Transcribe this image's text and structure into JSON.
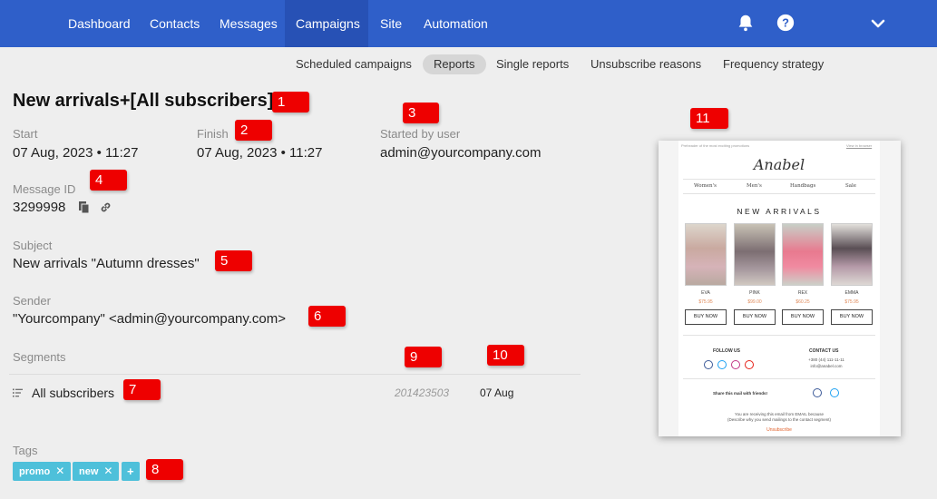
{
  "nav": {
    "items": [
      "Dashboard",
      "Contacts",
      "Messages",
      "Campaigns",
      "Site",
      "Automation"
    ],
    "active": "Campaigns"
  },
  "subnav": {
    "items": [
      "Scheduled campaigns",
      "Reports",
      "Single reports",
      "Unsubscribe reasons",
      "Frequency strategy"
    ],
    "active": "Reports"
  },
  "campaign": {
    "title": "New arrivals+[All subscribers]",
    "start_label": "Start",
    "start_value": "07 Aug, 2023 • 11:27",
    "finish_label": "Finish",
    "finish_value": "07 Aug, 2023 • 11:27",
    "started_by_label": "Started by user",
    "started_by_value": "admin@yourcompany.com",
    "message_id_label": "Message ID",
    "message_id_value": "3299998",
    "subject_label": "Subject",
    "subject_value": "New arrivals \"Autumn dresses\"",
    "sender_label": "Sender",
    "sender_value": "\"Yourcompany\" <admin@yourcompany.com>",
    "segments_label": "Segments",
    "segment": {
      "name": "All subscribers",
      "id": "201423503",
      "date": "07 Aug"
    },
    "tags_label": "Tags",
    "tags": [
      "promo",
      "new"
    ],
    "add_tag_label": "+"
  },
  "markers": [
    "1",
    "2",
    "3",
    "4",
    "5",
    "6",
    "7",
    "8",
    "9",
    "10",
    "11"
  ],
  "preview": {
    "preheader": "Preheader of the most exciting promotions",
    "view_browser": "View in browser",
    "logo": "Anabel",
    "menu": [
      "Women's",
      "Men's",
      "Handbags",
      "Sale"
    ],
    "heading": "NEW ARRIVALS",
    "products": [
      {
        "name": "EVA",
        "price": "$75.95"
      },
      {
        "name": "PINK",
        "price": "$99.00"
      },
      {
        "name": "REX",
        "price": "$60.25"
      },
      {
        "name": "EMMA",
        "price": "$75.95"
      }
    ],
    "buy_label": "BUY NOW",
    "follow_us": "FOLLOW US",
    "contact_us": "CONTACT US",
    "phone": "+380 (44) 111-11-11",
    "email": "info@anabel.com",
    "share_text": "Share this mail with friends!",
    "footer_1": "You are receiving this email from EMAIL because",
    "footer_2": "(Describe why you send mailings to the contact segment)",
    "unsubscribe": "Unsubscribe"
  },
  "colors": {
    "nav": "#2f5fc9",
    "badge": "#ee0000",
    "tag": "#4ec0da"
  }
}
